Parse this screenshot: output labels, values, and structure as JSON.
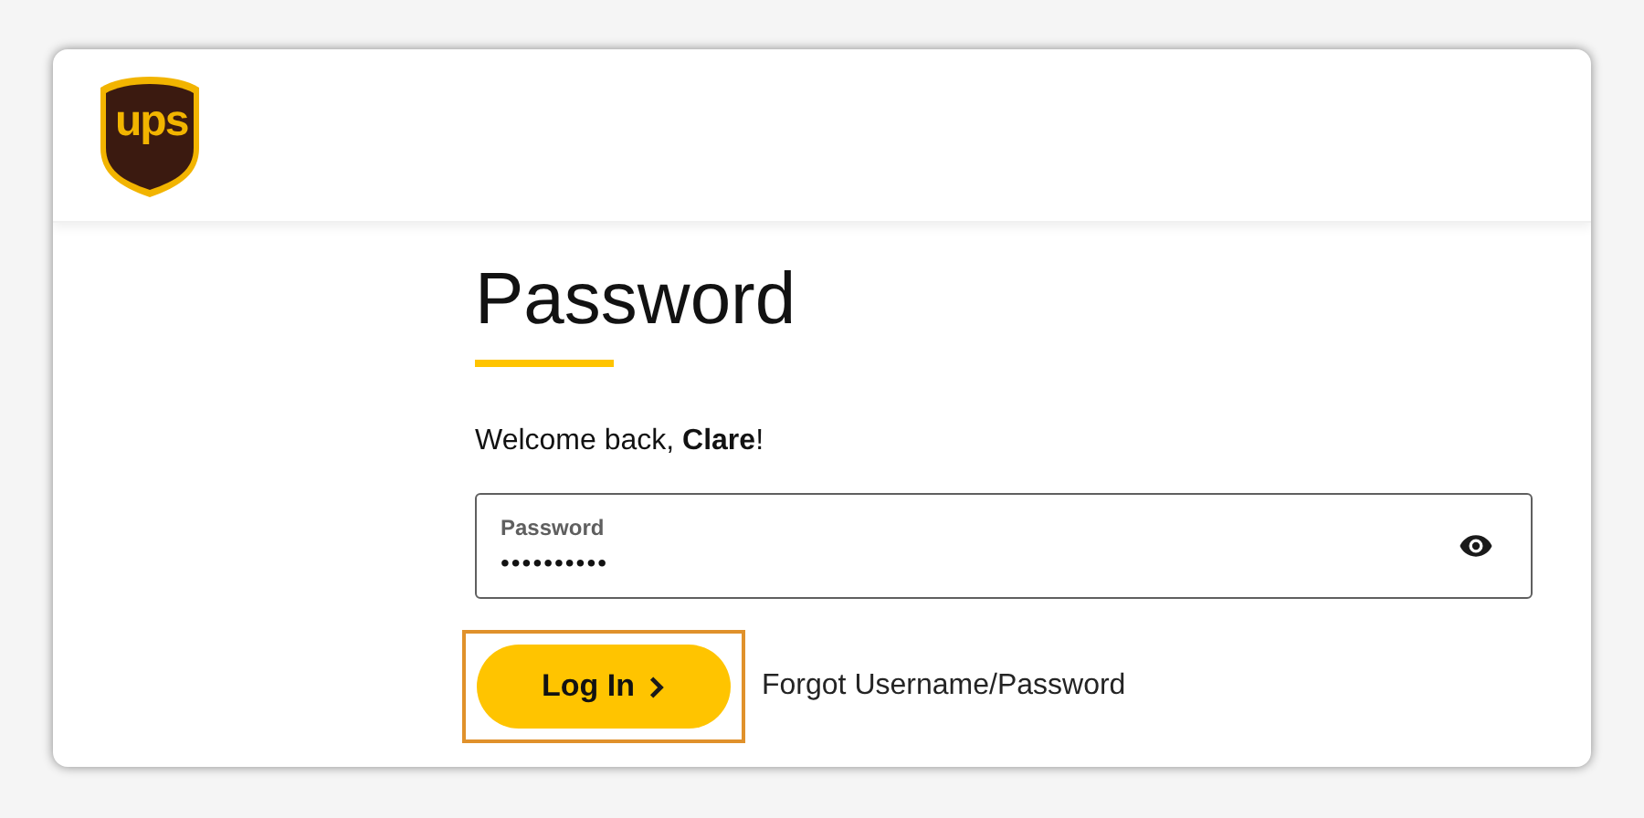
{
  "logo": {
    "text": "ups"
  },
  "heading": "Password",
  "welcome": "Welcome back, **Clare**!",
  "password_field": {
    "label": "Password",
    "value": "••••••••••"
  },
  "login_button": {
    "label": "Log In",
    "focused": true
  },
  "forgot_link": "Forgot Username/Password"
}
